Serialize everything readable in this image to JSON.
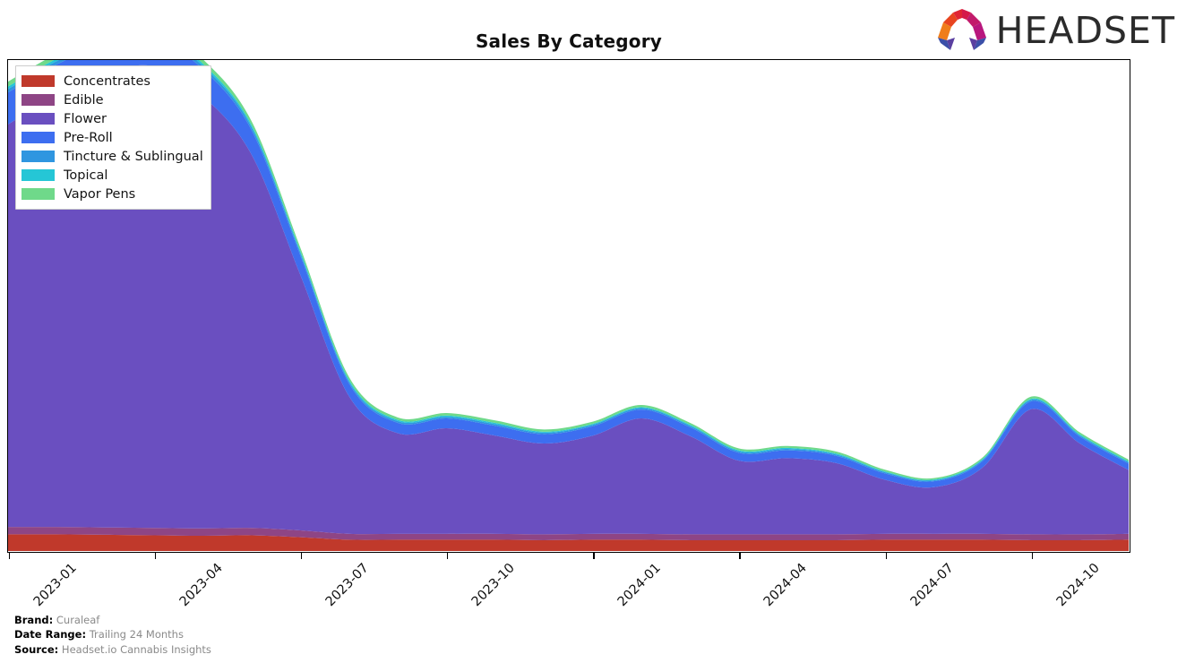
{
  "header": {
    "title": "Sales By Category",
    "logo_word": "HEADSET",
    "logo_icon": "headset-arch-logo"
  },
  "legend": {
    "position": "top-left",
    "items": [
      {
        "label": "Concentrates",
        "color": "#c0392b"
      },
      {
        "label": "Edible",
        "color": "#8e4585"
      },
      {
        "label": "Flower",
        "color": "#6a4fc0"
      },
      {
        "label": "Pre-Roll",
        "color": "#3d6ef0"
      },
      {
        "label": "Tincture & Sublingual",
        "color": "#2f96e0"
      },
      {
        "label": "Topical",
        "color": "#25c6d6"
      },
      {
        "label": "Vapor Pens",
        "color": "#6fd98a"
      }
    ]
  },
  "footer": {
    "rows": [
      {
        "key": "Brand:",
        "value": "Curaleaf"
      },
      {
        "key": "Date Range:",
        "value": "Trailing 24 Months"
      },
      {
        "key": "Source:",
        "value": "Headset.io Cannabis Insights"
      }
    ]
  },
  "chart_data": {
    "type": "area",
    "stacked": true,
    "title": "Sales By Category",
    "xlabel": "",
    "ylabel": "",
    "grid": false,
    "legend_position": "top-left",
    "x": [
      "2023-01",
      "2023-02",
      "2023-03",
      "2023-04",
      "2023-05",
      "2023-06",
      "2023-07",
      "2023-08",
      "2023-09",
      "2023-10",
      "2023-11",
      "2023-12",
      "2024-01",
      "2024-02",
      "2024-03",
      "2024-04",
      "2024-05",
      "2024-06",
      "2024-07",
      "2024-08",
      "2024-09",
      "2024-10",
      "2024-11",
      "2024-12"
    ],
    "xtick_labels": [
      "2023-01",
      "2023-04",
      "2023-07",
      "2023-10",
      "2024-01",
      "2024-04",
      "2024-07",
      "2024-10"
    ],
    "xtick_positions": [
      0,
      3,
      6,
      9,
      12,
      15,
      18,
      21
    ],
    "ylim": [
      0,
      100
    ],
    "series": [
      {
        "name": "Concentrates",
        "color": "#c0392b",
        "values": [
          3.4,
          3.4,
          3.3,
          3.2,
          3.1,
          3.2,
          2.8,
          2.3,
          2.3,
          2.3,
          2.3,
          2.2,
          2.3,
          2.3,
          2.2,
          2.2,
          2.2,
          2.2,
          2.3,
          2.3,
          2.3,
          2.2,
          2.2,
          2.3
        ]
      },
      {
        "name": "Edible",
        "color": "#8e4585",
        "values": [
          1.5,
          1.5,
          1.5,
          1.5,
          1.5,
          1.5,
          1.4,
          1.2,
          1.2,
          1.2,
          1.2,
          1.2,
          1.2,
          1.2,
          1.2,
          1.2,
          1.2,
          1.2,
          1.2,
          1.2,
          1.2,
          1.2,
          1.2,
          1.2
        ]
      },
      {
        "name": "Flower",
        "color": "#6a4fc0",
        "values": [
          82.0,
          88.0,
          92.5,
          94.0,
          88.0,
          76.0,
          52.0,
          28.0,
          20.5,
          21.5,
          20.0,
          18.5,
          20.0,
          23.5,
          20.0,
          15.0,
          15.5,
          14.5,
          11.0,
          9.5,
          13.5,
          25.5,
          18.5,
          13.0
        ]
      },
      {
        "name": "Pre-Roll",
        "color": "#3d6ef0",
        "values": [
          6.5,
          6.2,
          6.0,
          5.8,
          5.5,
          5.0,
          4.0,
          2.6,
          2.1,
          2.0,
          2.0,
          1.9,
          1.9,
          1.8,
          1.8,
          1.6,
          1.6,
          1.5,
          1.3,
          1.2,
          1.3,
          1.6,
          1.4,
          1.3
        ]
      },
      {
        "name": "Tincture & Sublingual",
        "color": "#2f96e0",
        "values": [
          0.7,
          0.7,
          0.7,
          0.7,
          0.7,
          0.6,
          0.5,
          0.4,
          0.35,
          0.35,
          0.35,
          0.3,
          0.3,
          0.3,
          0.3,
          0.3,
          0.3,
          0.25,
          0.25,
          0.2,
          0.25,
          0.3,
          0.25,
          0.25
        ]
      },
      {
        "name": "Topical",
        "color": "#25c6d6",
        "values": [
          0.5,
          0.5,
          0.5,
          0.5,
          0.45,
          0.4,
          0.35,
          0.3,
          0.25,
          0.25,
          0.25,
          0.2,
          0.2,
          0.2,
          0.2,
          0.2,
          0.2,
          0.2,
          0.15,
          0.15,
          0.15,
          0.2,
          0.2,
          0.2
        ]
      },
      {
        "name": "Vapor Pens",
        "color": "#6fd98a",
        "values": [
          1.0,
          1.0,
          1.0,
          1.0,
          0.9,
          0.8,
          0.7,
          0.6,
          0.5,
          0.5,
          0.5,
          0.45,
          0.45,
          0.45,
          0.4,
          0.4,
          0.4,
          0.4,
          0.35,
          0.3,
          0.35,
          0.45,
          0.4,
          0.35
        ]
      }
    ]
  }
}
